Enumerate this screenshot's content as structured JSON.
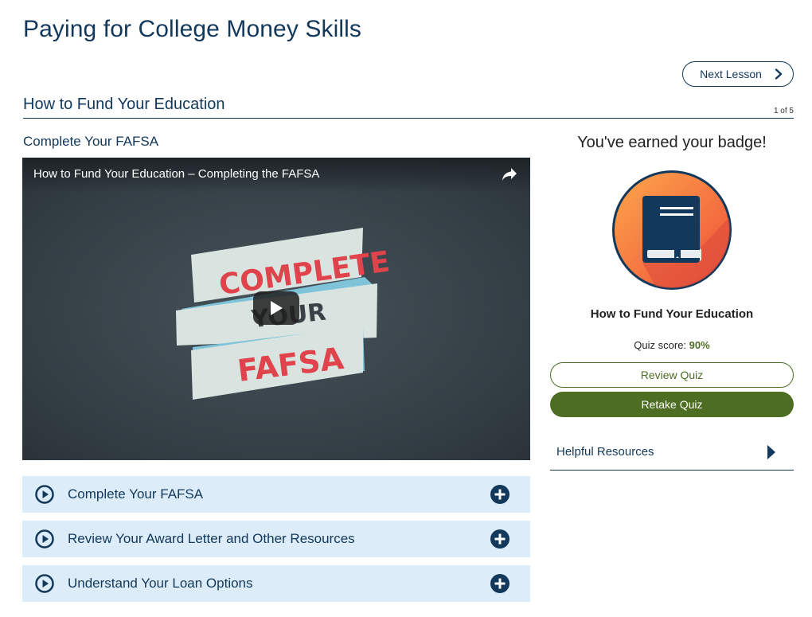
{
  "page": {
    "title": "Paying for College Money Skills"
  },
  "nav": {
    "next_label": "Next Lesson"
  },
  "lesson": {
    "title": "How to Fund Your Education",
    "counter": "1 of 5"
  },
  "section": {
    "title": "Complete Your FAFSA"
  },
  "video": {
    "title": "How to Fund Your Education – Completing the FAFSA",
    "ribbon_lines": [
      "COMPLETE",
      "YOUR",
      "FAFSA"
    ],
    "icons": {
      "share": "share-arrow-icon",
      "play": "play-icon"
    }
  },
  "accordion": [
    {
      "label": "Complete Your FAFSA"
    },
    {
      "label": "Review Your Award Letter and Other Resources"
    },
    {
      "label": "Understand Your Loan Options"
    }
  ],
  "badge": {
    "heading": "You've earned your badge!",
    "name": "How to Fund Your Education",
    "score_label": "Quiz score:",
    "score_value": "90%",
    "icon": "book-badge-icon"
  },
  "actions": {
    "review_label": "Review Quiz",
    "retake_label": "Retake Quiz"
  },
  "resources": {
    "label": "Helpful Resources"
  },
  "colors": {
    "navy": "#12385b",
    "green": "#4c6d22",
    "accordion_bg": "#dcecf8",
    "ribbon_red": "#e0434b",
    "ribbon_blue": "#7ec3d8"
  }
}
